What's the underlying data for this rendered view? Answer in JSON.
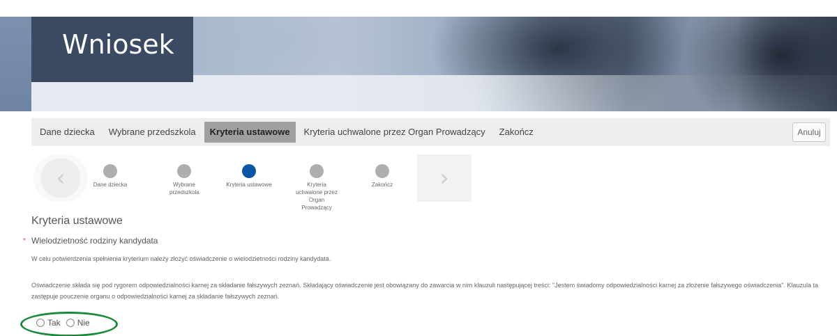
{
  "header": {
    "title": "Wniosek"
  },
  "nav": {
    "tabs": [
      {
        "label": "Dane dziecka",
        "active": false
      },
      {
        "label": "Wybrane przedszkola",
        "active": false
      },
      {
        "label": "Kryteria ustawowe",
        "active": true
      },
      {
        "label": "Kryteria uchwalone przez Organ Prowadzący",
        "active": false
      },
      {
        "label": "Zakończ",
        "active": false
      }
    ],
    "cancel_label": "Anuluj"
  },
  "stepper": {
    "prev_glyph": "‹",
    "next_glyph": "›",
    "steps": [
      {
        "label": "Dane dziecka",
        "active": false
      },
      {
        "label": "Wybrane przedszkola",
        "active": false
      },
      {
        "label": "Kryteria ustawowe",
        "active": true
      },
      {
        "label": "Kryteria uchwalone przez Organ Prowadzący",
        "active": false
      },
      {
        "label": "Zakończ",
        "active": false
      }
    ],
    "active_color": "#0a55a6",
    "inactive_color": "#aeaeae"
  },
  "content": {
    "section_title": "Kryteria ustawowe",
    "required_marker": "*",
    "criterion_label": "Wielodzietność rodziny kandydata",
    "paragraph1": "W celu potwierdzenia spełnienia kryterium należy złożyć oświadczenie o wielodzietności rodziny kandydata.",
    "paragraph2": "Oświadczenie składa się pod rygorem odpowiedzialności karnej za składanie fałszywych zeznań. Składający oświadczenie jest obowiązany do zawarcia w nim klauzuli następującej treści: \"Jestem świadomy odpowiedzialności karnej za złożenie fałszywego oświadczenia\". Klauzula ta zastępuje pouczenie organu o odpowiedzialności karnej za składanie fałszywych zeznań.",
    "options": [
      {
        "label": "Tak",
        "selected": false
      },
      {
        "label": "Nie",
        "selected": false
      }
    ],
    "highlight_color": "#1a8a3a"
  }
}
